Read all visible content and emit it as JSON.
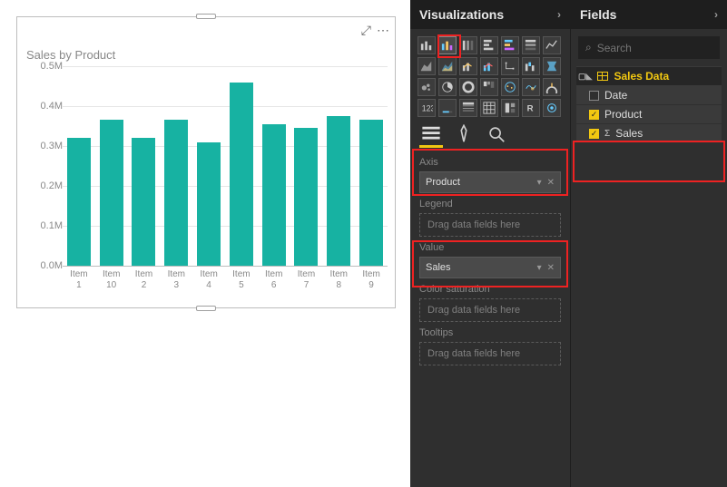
{
  "panels": {
    "visualizations": "Visualizations",
    "fields": "Fields"
  },
  "chart_data": {
    "type": "bar",
    "title": "Sales by Product",
    "categories": [
      "Item 1",
      "Item 10",
      "Item 2",
      "Item 3",
      "Item 4",
      "Item 5",
      "Item 6",
      "Item 7",
      "Item 8",
      "Item 9"
    ],
    "values": [
      320000,
      365000,
      320000,
      365000,
      310000,
      460000,
      355000,
      345000,
      375000,
      365000
    ],
    "ylabel": "",
    "xlabel": "",
    "ylim": [
      0,
      500000
    ],
    "y_ticks": [
      "0.0M",
      "0.1M",
      "0.2M",
      "0.3M",
      "0.4M",
      "0.5M"
    ]
  },
  "wells": {
    "axis": {
      "label": "Axis",
      "value": "Product"
    },
    "legend": {
      "label": "Legend",
      "placeholder": "Drag data fields here"
    },
    "value": {
      "label": "Value",
      "value": "Sales"
    },
    "saturation": {
      "label": "Color saturation",
      "placeholder": "Drag data fields here"
    },
    "tooltips": {
      "label": "Tooltips",
      "placeholder": "Drag data fields here"
    }
  },
  "search": {
    "placeholder": "Search"
  },
  "tree": {
    "table": "Sales Data",
    "fields": [
      {
        "name": "Date",
        "checked": false,
        "agg": false
      },
      {
        "name": "Product",
        "checked": true,
        "agg": false
      },
      {
        "name": "Sales",
        "checked": true,
        "agg": true
      }
    ]
  }
}
